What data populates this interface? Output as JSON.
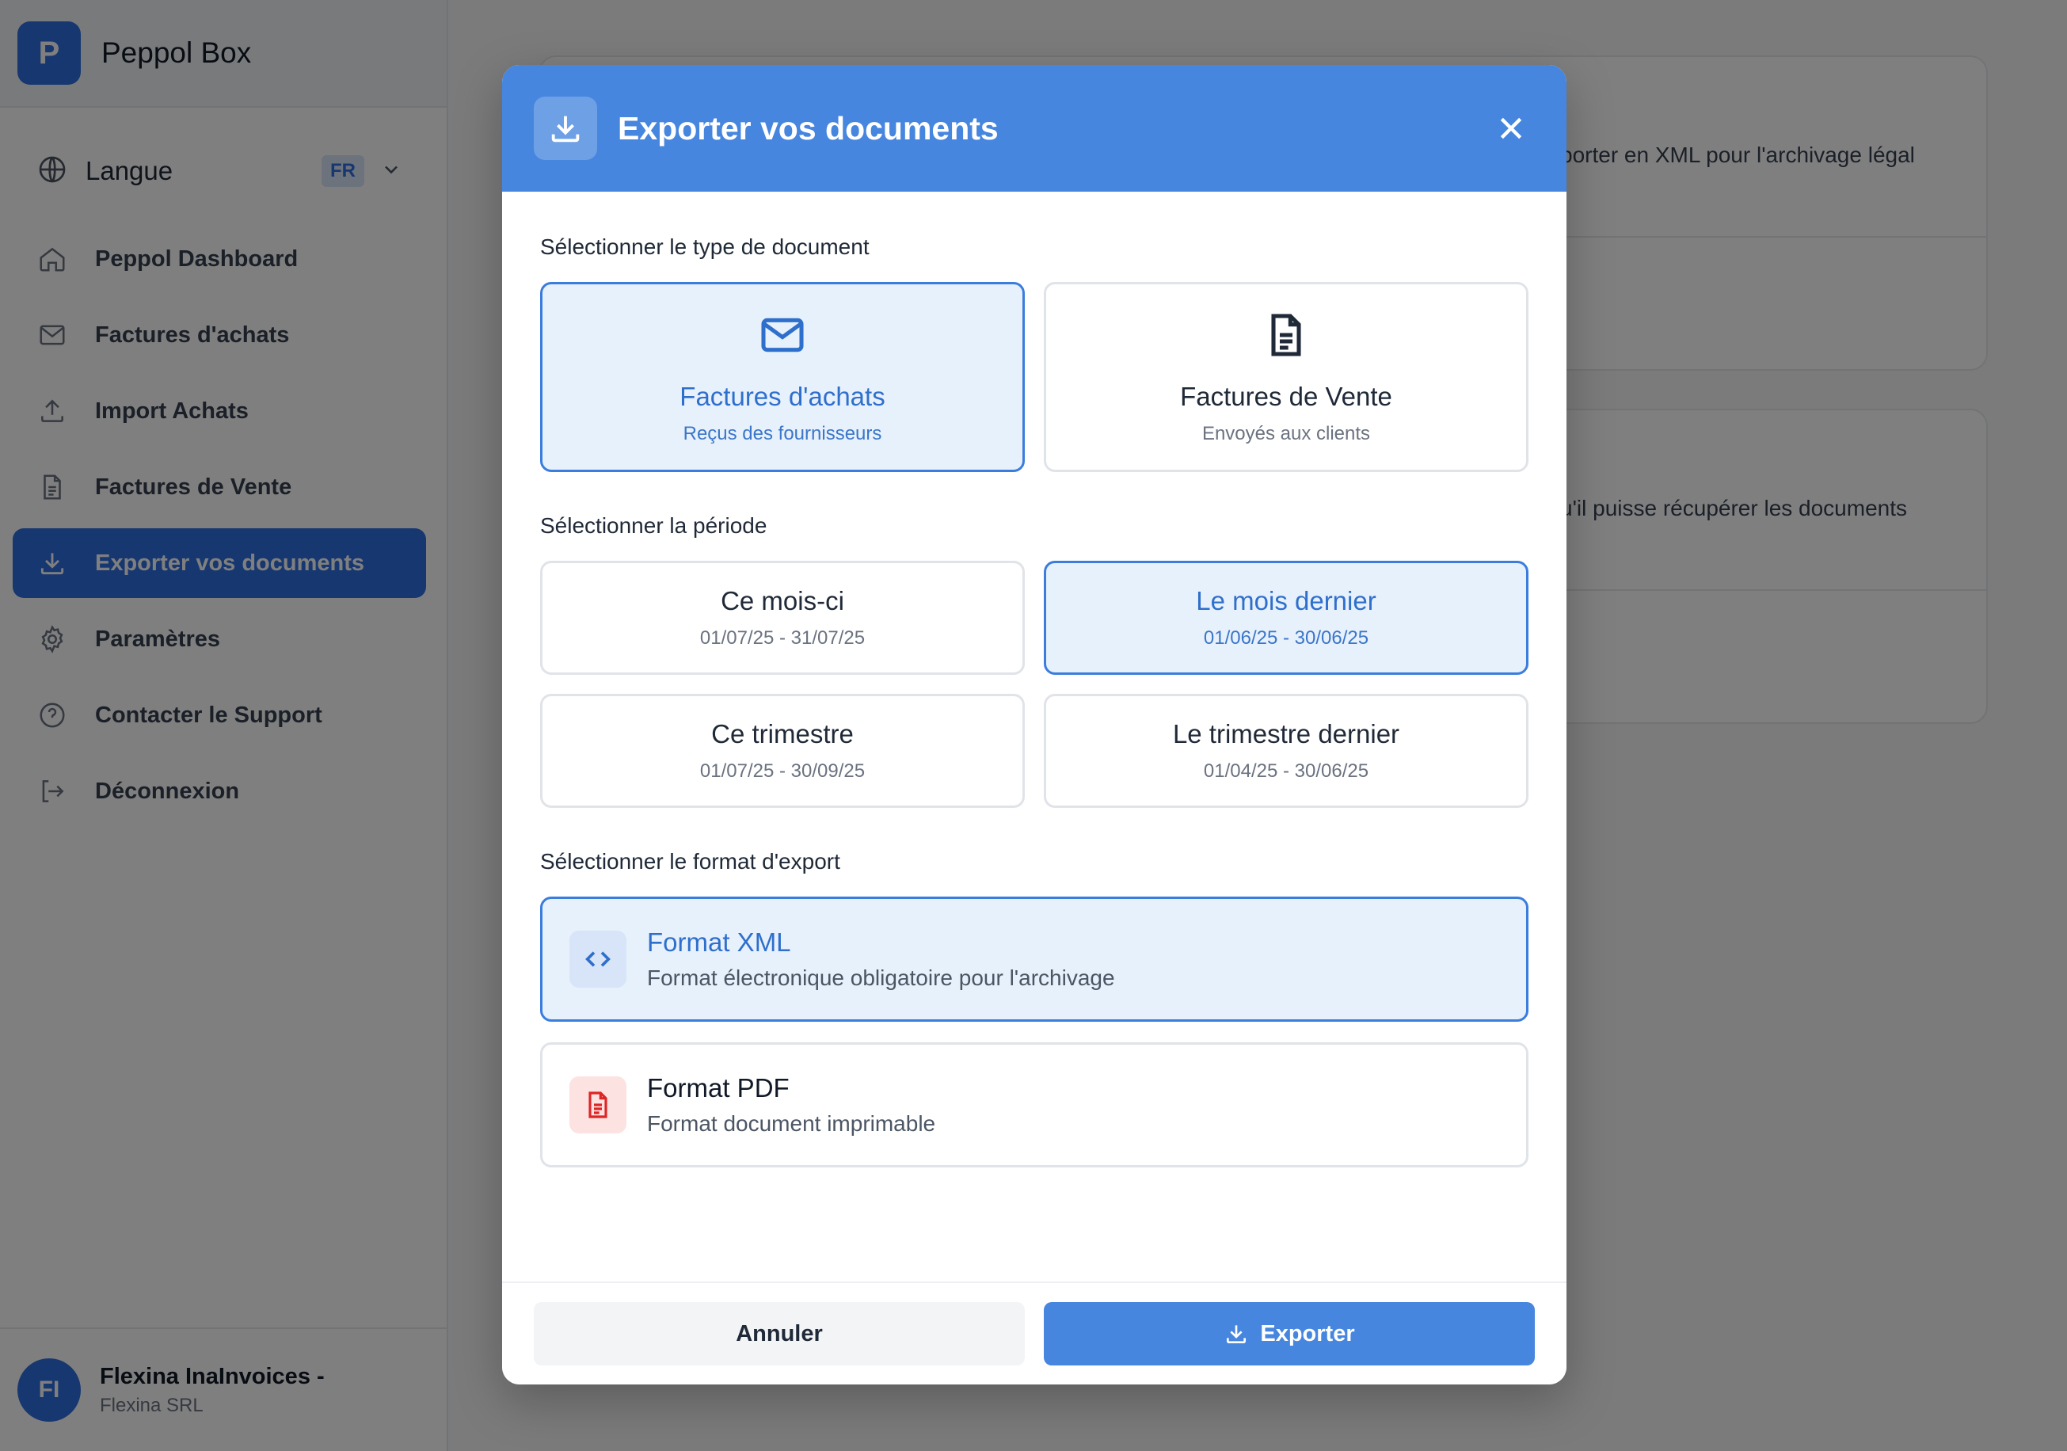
{
  "app": {
    "logo_letter": "P",
    "name": "Peppol Box"
  },
  "sidebar": {
    "language": {
      "label": "Langue",
      "code": "FR"
    },
    "items": [
      {
        "label": "Peppol Dashboard",
        "icon": "home-icon"
      },
      {
        "label": "Factures d'achats",
        "icon": "mail-icon"
      },
      {
        "label": "Import Achats",
        "icon": "upload-icon"
      },
      {
        "label": "Factures de Vente",
        "icon": "document-icon"
      },
      {
        "label": "Exporter vos documents",
        "icon": "download-icon",
        "active": true
      },
      {
        "label": "Paramètres",
        "icon": "gear-icon"
      },
      {
        "label": "Contacter le Support",
        "icon": "help-icon"
      },
      {
        "label": "Déconnexion",
        "icon": "logout-icon"
      }
    ],
    "user": {
      "initials": "FI",
      "name": "Flexina InaInvoices -",
      "org": "Flexina SRL"
    }
  },
  "background": {
    "card1_text": "porter en XML pour l'archivage légal",
    "card2_text": "u'il puisse récupérer les documents"
  },
  "modal": {
    "title": "Exporter vos documents",
    "doc_type_label": "Sélectionner le type de document",
    "doc_types": [
      {
        "title": "Factures d'achats",
        "subtitle": "Reçus des fournisseurs",
        "selected": true
      },
      {
        "title": "Factures de Vente",
        "subtitle": "Envoyés aux clients",
        "selected": false
      }
    ],
    "period_label": "Sélectionner la période",
    "periods": [
      {
        "title": "Ce mois-ci",
        "range": "01/07/25 - 31/07/25",
        "selected": false
      },
      {
        "title": "Le mois dernier",
        "range": "01/06/25 - 30/06/25",
        "selected": true
      },
      {
        "title": "Ce trimestre",
        "range": "01/07/25 - 30/09/25",
        "selected": false
      },
      {
        "title": "Le trimestre dernier",
        "range": "01/04/25 - 30/06/25",
        "selected": false
      }
    ],
    "format_label": "Sélectionner le format d'export",
    "formats": [
      {
        "title": "Format XML",
        "desc": "Format électronique obligatoire pour l'archivage",
        "selected": true
      },
      {
        "title": "Format PDF",
        "desc": "Format document imprimable",
        "selected": false
      }
    ],
    "cancel_label": "Annuler",
    "export_label": "Exporter"
  },
  "colors": {
    "accent": "#4686df",
    "selected_bg": "#e7f1fc",
    "selected_border": "#3b7ddd",
    "pdf_icon": "#dc2626"
  }
}
